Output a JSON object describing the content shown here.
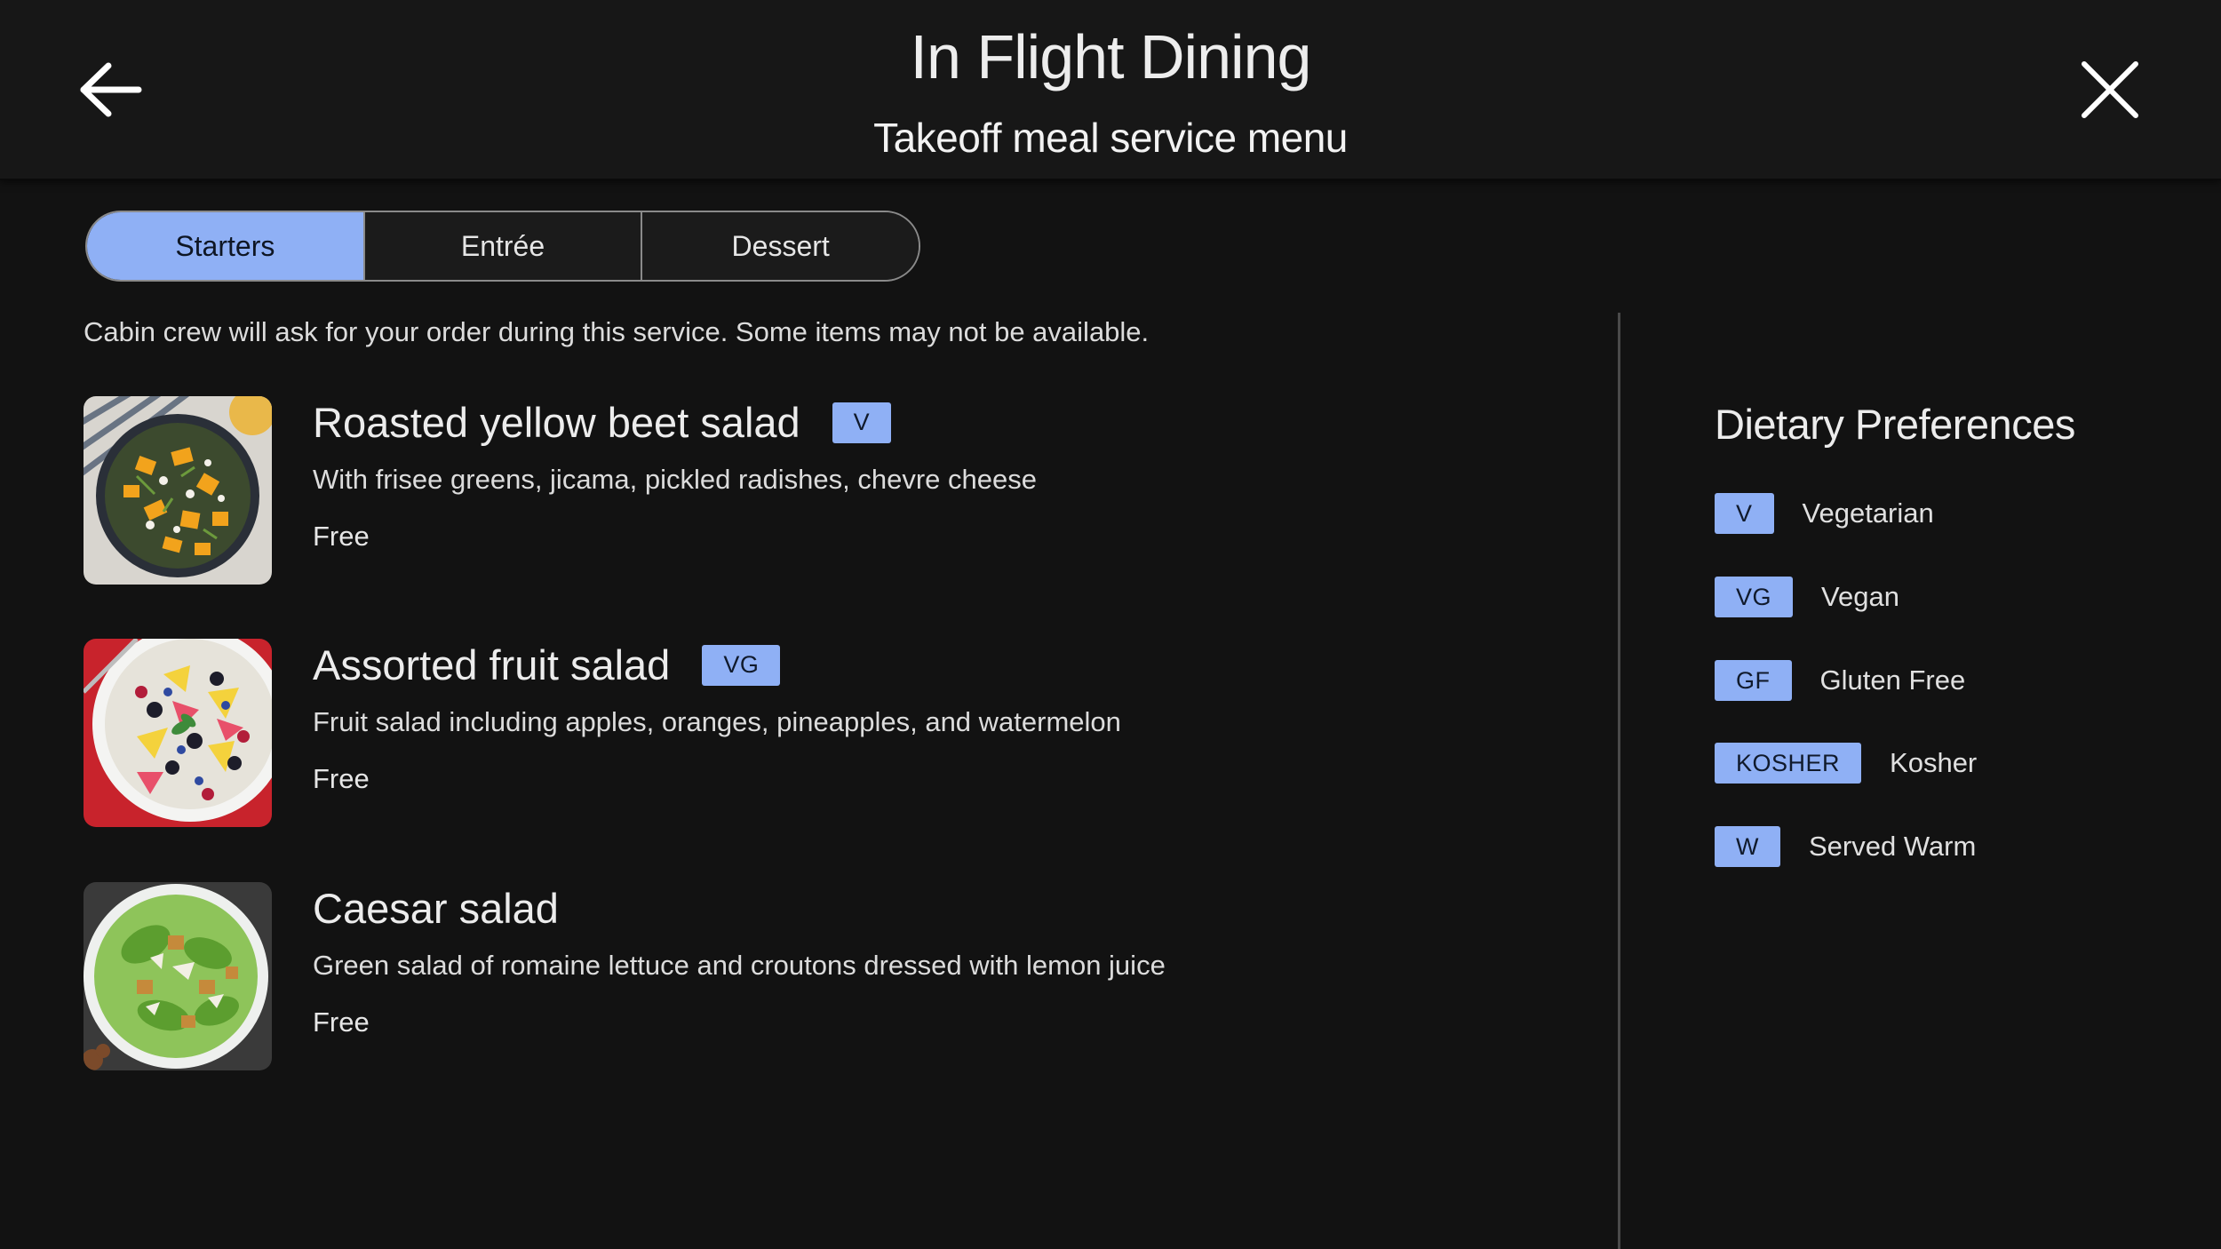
{
  "header": {
    "title": "In Flight Dining",
    "subtitle": "Takeoff meal service menu",
    "back_icon": "arrow-left-icon",
    "close_icon": "close-icon"
  },
  "tabs": [
    {
      "label": "Starters",
      "active": true
    },
    {
      "label": "Entrée",
      "active": false
    },
    {
      "label": "Dessert",
      "active": false
    }
  ],
  "notice": "Cabin crew will ask for your order during this service. Some items may not be available.",
  "items": [
    {
      "name": "Roasted yellow beet salad",
      "tag": "V",
      "description": "With frisee greens, jicama, pickled radishes, chevre cheese",
      "price": "Free"
    },
    {
      "name": "Assorted fruit salad",
      "tag": "VG",
      "description": "Fruit salad including apples, oranges, pineapples, and watermelon",
      "price": "Free"
    },
    {
      "name": "Caesar salad",
      "tag": "",
      "description": "Green salad of romaine lettuce and croutons dressed with lemon juice",
      "price": "Free"
    }
  ],
  "dietary": {
    "title": "Dietary Preferences",
    "entries": [
      {
        "tag": "V",
        "label": "Vegetarian"
      },
      {
        "tag": "VG",
        "label": "Vegan"
      },
      {
        "tag": "GF",
        "label": "Gluten Free"
      },
      {
        "tag": "KOSHER",
        "label": "Kosher"
      },
      {
        "tag": "W",
        "label": "Served Warm"
      }
    ]
  },
  "colors": {
    "background": "#121212",
    "header": "#171717",
    "accent": "#8fb0f5",
    "divider": "#4a4a4a"
  }
}
